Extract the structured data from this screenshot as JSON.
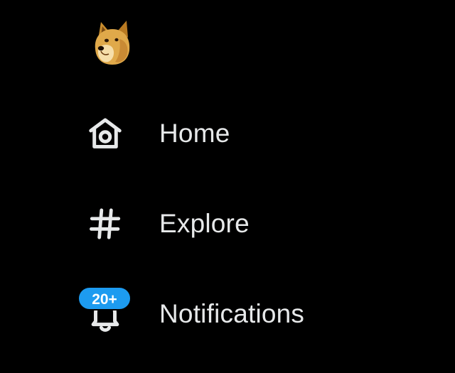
{
  "nav": {
    "logo": {
      "icon": "doge-avatar-icon"
    },
    "items": [
      {
        "label": "Home",
        "icon": "home-icon"
      },
      {
        "label": "Explore",
        "icon": "hashtag-icon"
      },
      {
        "label": "Notifications",
        "icon": "bell-icon",
        "badge": "20+"
      }
    ]
  },
  "colors": {
    "background": "#000000",
    "text": "#e7e9ea",
    "badge": "#1d9bf0",
    "badge_text": "#ffffff"
  }
}
